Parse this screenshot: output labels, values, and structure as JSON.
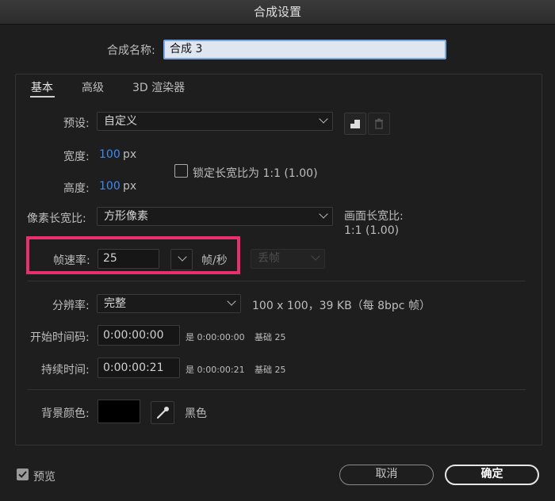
{
  "window": {
    "title": "合成设置"
  },
  "name_field": {
    "label": "合成名称:",
    "value": "合成 3"
  },
  "tabs": [
    {
      "label": "基本",
      "active": true
    },
    {
      "label": "高级",
      "active": false
    },
    {
      "label": "3D 渲染器",
      "active": false
    }
  ],
  "preset": {
    "label": "预设:",
    "value": "自定义"
  },
  "width": {
    "label": "宽度:",
    "value": "100",
    "unit": "px"
  },
  "height": {
    "label": "高度:",
    "value": "100",
    "unit": "px"
  },
  "lock_aspect": {
    "label": "锁定长宽比为 1:1 (1.00)",
    "checked": false
  },
  "pixel_aspect": {
    "label": "像素长宽比:",
    "value": "方形像素"
  },
  "frame_aspect": {
    "label": "画面长宽比:",
    "value": "1:1 (1.00)"
  },
  "frame_rate": {
    "label": "帧速率:",
    "value": "25",
    "unit": "帧/秒",
    "drop_frame": "丢帧"
  },
  "resolution": {
    "label": "分辨率:",
    "value": "完整",
    "info": "100 x 100，39 KB（每 8bpc 帧）"
  },
  "start_timecode": {
    "label": "开始时间码:",
    "value": "0:00:00:00",
    "info_prefix": "是 0:00:00:00",
    "info_base": "基础 25"
  },
  "duration": {
    "label": "持续时间:",
    "value": "0:00:00:21",
    "info_prefix": "是 0:00:00:21",
    "info_base": "基础 25"
  },
  "background": {
    "label": "背景颜色:",
    "color": "#000000",
    "color_name": "黑色"
  },
  "footer": {
    "preview_label": "预览",
    "preview_checked": true,
    "cancel_label": "取消",
    "ok_label": "确定"
  },
  "colors": {
    "accent_blue": "#3d8bf2",
    "highlight": "#e8306e"
  }
}
